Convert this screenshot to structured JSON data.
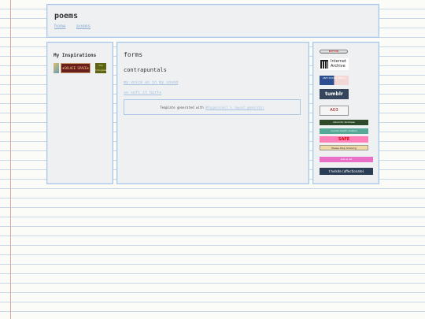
{
  "header": {
    "title": "poems",
    "nav": [
      "home",
      "poems"
    ]
  },
  "sidebar_left": {
    "title": "My Inspirations",
    "inspirations": [
      {
        "name": "inspiration-1",
        "label": ""
      },
      {
        "name": "inspiration-2",
        "label": "♦SOLACE SPACE♦"
      },
      {
        "name": "inspiration-3",
        "label": "the thingmaker"
      }
    ]
  },
  "main": {
    "title": "forms",
    "subtitle": "contrapuntals",
    "links": [
      "my voice as in my sound",
      "so soft it hurts"
    ],
    "footer_prefix": "Template generated with",
    "footer_link": "Whippersnell's layout generator"
  },
  "sidebar_right": {
    "buttons": [
      {
        "name": "button-badge",
        "label": "BUTTON"
      },
      {
        "name": "internet-archive-badge",
        "label1": "Internet",
        "label2": "Archive"
      },
      {
        "name": "anti-social-media-badge",
        "label": "ANTI SOCIAL MEDIA"
      },
      {
        "name": "tumblr-badge",
        "label": "tumblr"
      },
      {
        "name": "ao3-badge",
        "label": "AO3"
      },
      {
        "name": "stand-for-kindness-badge",
        "label": "stand for kindness"
      },
      {
        "name": "green-badge",
        "label": "mental health matters"
      },
      {
        "name": "safe-badge",
        "label": "SAFE"
      },
      {
        "name": "please-stop-smoking-badge",
        "label": "Please Stop Smoking"
      },
      {
        "name": "pink-badge",
        "label": "anti-ai art"
      },
      {
        "name": "helsite-badge",
        "label": "t  helsite (affectionate)"
      }
    ]
  }
}
